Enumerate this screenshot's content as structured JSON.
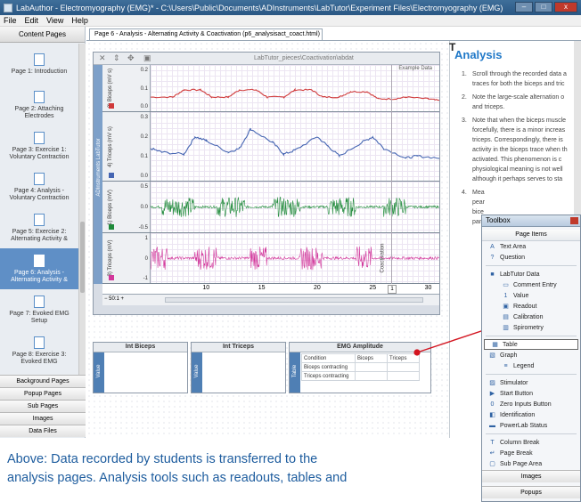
{
  "window": {
    "title": "LabAuthor - Electromyography (EMG)* - C:\\Users\\Public\\Documents\\ADInstruments\\LabTutor\\Experiment Files\\Electromyography (EMG)",
    "minimize": "–",
    "maximize": "□",
    "close": "x"
  },
  "menu": {
    "file": "File",
    "edit": "Edit",
    "view": "View",
    "help": "Help"
  },
  "sidebar": {
    "header": "Content Pages",
    "pages": [
      {
        "label": "Page 1: Introduction"
      },
      {
        "label": "Page 2: Attaching Electrodes"
      },
      {
        "label": "Page 3: Exercise 1: Voluntary Contraction"
      },
      {
        "label": "Page 4: Analysis - Voluntary Contraction"
      },
      {
        "label": "Page 5: Exercise 2: Alternating Activity &"
      },
      {
        "label": "Page 6: Analysis - Alternating Activity &"
      },
      {
        "label": "Page 7: Evoked EMG Setup"
      },
      {
        "label": "Page 8: Exercise 3: Evoked EMG"
      }
    ],
    "tabs": [
      "Background Pages",
      "Popup Pages",
      "Sub Pages",
      "Images",
      "Data Files"
    ]
  },
  "document_tab": "Page 6 - Analysis - Alternating Activity & Coactivation (p6_analysisact_coact.html)",
  "chart": {
    "toolbar_path": "LabTutor_pieces\\Coactivation\\abdat",
    "example_label": "Example Data",
    "brand": "ADInstruments LabTutor",
    "coactivation_label": "Coactivation",
    "cursor_value": "1",
    "zoom": "50:1",
    "colors": {
      "biceps_rms": "#d0393a",
      "triceps_rms": "#4565b2",
      "biceps": "#1f8a3a",
      "triceps": "#d2379b"
    }
  },
  "chart_data": {
    "type": "line",
    "xlabel": "",
    "x_ticks": [
      "10",
      "15",
      "20",
      "25",
      "30"
    ],
    "xlim": [
      5,
      31
    ],
    "series": [
      {
        "name": "2) Biceps (mV s)",
        "ylim": [
          0,
          0.2
        ],
        "y_ticks": [
          "0.2",
          "0.1",
          "0.0"
        ],
        "x": [
          5,
          7,
          8,
          9.5,
          10.5,
          12,
          13,
          14.5,
          15.5,
          17,
          18,
          19.5,
          20.5,
          22,
          23,
          24.5,
          25.5,
          27,
          28,
          30,
          31
        ],
        "values": [
          0.05,
          0.05,
          0.09,
          0.09,
          0.05,
          0.05,
          0.09,
          0.09,
          0.05,
          0.05,
          0.09,
          0.09,
          0.05,
          0.05,
          0.08,
          0.08,
          0.04,
          0.04,
          0.05,
          0.04,
          0.03
        ]
      },
      {
        "name": "4) Triceps (mV s)",
        "ylim": [
          0,
          0.3
        ],
        "y_ticks": [
          "0.3",
          "0.2",
          "0.1",
          "0.0"
        ],
        "x": [
          5,
          6,
          8,
          9,
          10,
          12,
          13,
          14,
          16,
          17,
          18,
          20,
          21,
          22,
          24,
          25,
          26,
          28,
          29,
          31
        ],
        "values": [
          0.14,
          0.12,
          0.11,
          0.2,
          0.18,
          0.12,
          0.14,
          0.24,
          0.17,
          0.11,
          0.13,
          0.2,
          0.15,
          0.1,
          0.17,
          0.2,
          0.14,
          0.09,
          0.1,
          0.09
        ]
      },
      {
        "name": "1) Biceps (mV)",
        "ylim": [
          -0.5,
          0.5
        ],
        "y_ticks": [
          "0.5",
          "0.0",
          "-0.5"
        ],
        "bursts": [
          [
            6,
            9
          ],
          [
            11,
            13.5
          ],
          [
            16,
            18.5
          ],
          [
            21,
            23.5
          ],
          [
            26,
            28
          ]
        ],
        "amplitude": 0.25
      },
      {
        "name": "3) Triceps (mV)",
        "ylim": [
          -1,
          1
        ],
        "y_ticks": [
          "1",
          "0",
          "-1"
        ],
        "bursts": [
          [
            5,
            6.5
          ],
          [
            9,
            11
          ],
          [
            14,
            15.5
          ],
          [
            18.5,
            20.5
          ],
          [
            23.5,
            25
          ]
        ],
        "amplitude": 0.6
      }
    ]
  },
  "tables": {
    "int_biceps": {
      "title": "Int Biceps",
      "side": "Value"
    },
    "int_triceps": {
      "title": "Int Triceps",
      "side": "Value"
    },
    "emg_amplitude": {
      "title": "EMG Amplitude",
      "side": "Table",
      "headers": [
        "Condition",
        "Biceps",
        "Triceps"
      ],
      "rows": [
        [
          "Biceps contracting",
          "",
          ""
        ],
        [
          "Triceps contracting",
          "",
          ""
        ]
      ]
    }
  },
  "analysis": {
    "heading": "Analysis",
    "items": [
      {
        "num": "1.",
        "lines": [
          "Scroll through the recorded data a",
          "traces for both the biceps and tric"
        ]
      },
      {
        "num": "2.",
        "lines": [
          "Note the large-scale alternation o",
          "and triceps."
        ]
      },
      {
        "num": "3.",
        "lines": [
          "Note that when the biceps muscle",
          "forcefully, there is a minor increas",
          "triceps. Correspondingly, there is",
          "activity in the biceps trace when th",
          "activated. This phenomenon is c",
          "physiological meaning is not well",
          "although it perhaps serves to sta"
        ]
      },
      {
        "num": "4.",
        "lines": [
          "Mea",
          "pear",
          "bice",
          "pane"
        ]
      }
    ]
  },
  "toolbox": {
    "title": "Toolbox",
    "section": "Page Items",
    "items": [
      {
        "icon": "A",
        "label": "Text Area",
        "indent": false
      },
      {
        "icon": "?",
        "label": "Question",
        "indent": false
      },
      {
        "sep": true
      },
      {
        "icon": "■",
        "label": "LabTutor Data",
        "indent": false
      },
      {
        "icon": "▭",
        "label": "Comment Entry",
        "indent": true
      },
      {
        "icon": "1",
        "label": "Value",
        "indent": true
      },
      {
        "icon": "▣",
        "label": "Readout",
        "indent": true
      },
      {
        "icon": "▤",
        "label": "Calibration",
        "indent": true
      },
      {
        "icon": "▥",
        "label": "Spirometry",
        "indent": true
      },
      {
        "sep": true
      },
      {
        "icon": "▦",
        "label": "Table",
        "indent": false,
        "highlight": true
      },
      {
        "icon": "▧",
        "label": "Graph",
        "indent": false
      },
      {
        "icon": "≡",
        "label": "Legend",
        "indent": true
      },
      {
        "sep": true
      },
      {
        "icon": "▨",
        "label": "Stimulator",
        "indent": false
      },
      {
        "icon": "▶",
        "label": "Start Button",
        "indent": false
      },
      {
        "icon": "0",
        "label": "Zero Inputs Button",
        "indent": false
      },
      {
        "icon": "◧",
        "label": "Identification",
        "indent": false
      },
      {
        "icon": "▬",
        "label": "PowerLab Status",
        "indent": false
      },
      {
        "sep": true
      },
      {
        "icon": "T",
        "label": "Column Break",
        "indent": false
      },
      {
        "icon": "↵",
        "label": "Page Break",
        "indent": false
      },
      {
        "icon": "▢",
        "label": "Sub Page Area",
        "indent": false
      }
    ],
    "bottom_tabs": [
      "Images",
      "Popups"
    ]
  },
  "caption": {
    "line1": "Above: Data recorded by students is transferred to the",
    "line2": "analysis pages. Analysis tools such as readouts, tables and"
  }
}
